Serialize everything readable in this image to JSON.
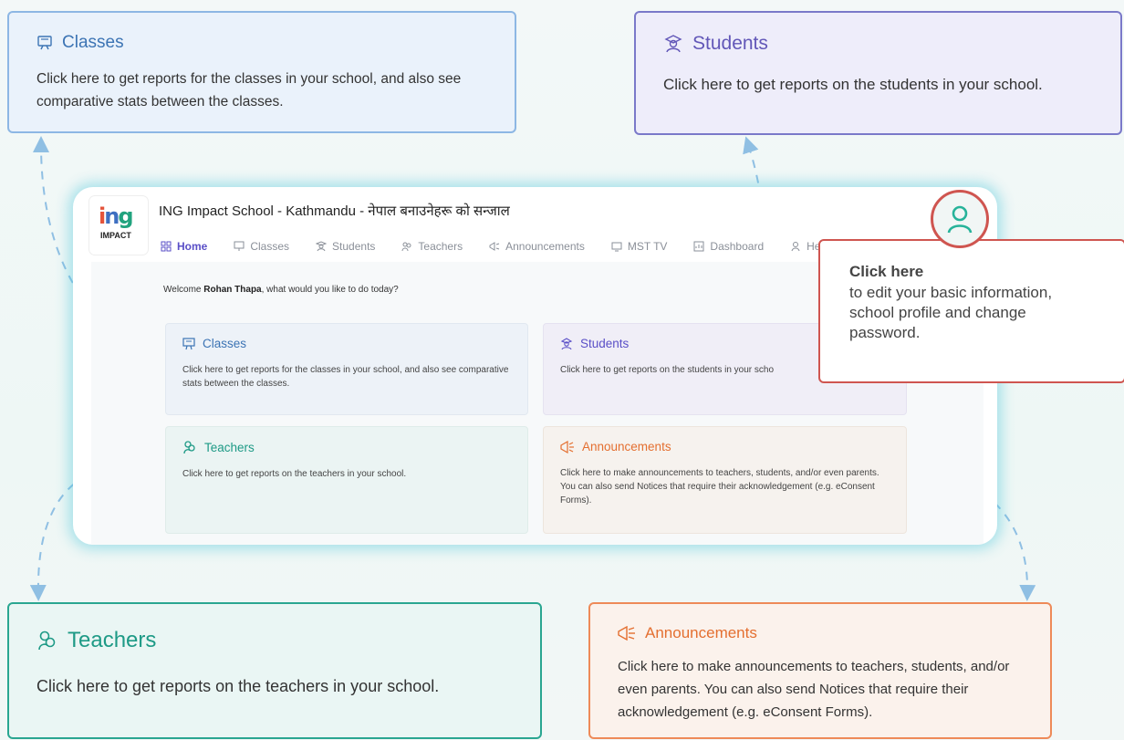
{
  "colors": {
    "classes": "#3c74b4",
    "students": "#6257b8",
    "teachers": "#1e9a86",
    "announcements": "#e46f30",
    "profile_border": "#cf5550",
    "nav_active": "#5a4fc7"
  },
  "callouts": {
    "classes": {
      "icon": "presentation-board-icon",
      "title": "Classes",
      "body": "Click here to get reports for the classes in your school, and also see comparative stats between the classes."
    },
    "students": {
      "icon": "student-graduate-icon",
      "title": "Students",
      "body": "Click here to get reports on the students in your school."
    },
    "teachers": {
      "icon": "teachers-group-icon",
      "title": "Teachers",
      "body": "Click here to get reports on the teachers in your school."
    },
    "announcements": {
      "icon": "megaphone-icon",
      "title": "Announcements",
      "body": "Click here to make announcements to teachers, students, and/or even parents. You can also send Notices that require their acknowledgement (e.g. eConsent Forms)."
    },
    "profile": {
      "icon": "user-profile-icon",
      "title": "Click here",
      "body": "to edit your basic information, school profile and change password."
    }
  },
  "app": {
    "logo_text": "ing",
    "logo_sub": "IMPACT",
    "school_name": "ING Impact School - Kathmandu - नेपाल बनाउनेहरू को सन्जाल",
    "nav": [
      {
        "label": "Home",
        "icon": "grid-icon",
        "active": true
      },
      {
        "label": "Classes",
        "icon": "presentation-board-icon"
      },
      {
        "label": "Students",
        "icon": "student-graduate-icon"
      },
      {
        "label": "Teachers",
        "icon": "teachers-group-icon"
      },
      {
        "label": "Announcements",
        "icon": "megaphone-icon"
      },
      {
        "label": "MST TV",
        "icon": "tv-icon"
      },
      {
        "label": "Dashboard",
        "icon": "dashboard-icon"
      },
      {
        "label": "He",
        "icon": "help-icon"
      }
    ],
    "welcome_prefix": "Welcome ",
    "welcome_name": "Rohan Thapa",
    "welcome_suffix": ", what would you like to do today?",
    "cards": {
      "classes": {
        "title": "Classes",
        "body": "Click here to get reports for the classes in your school, and also see comparative stats between the classes."
      },
      "students": {
        "title": "Students",
        "body": "Click here to get reports on the students in your scho"
      },
      "teachers": {
        "title": "Teachers",
        "body": "Click here to get reports on the teachers in your school."
      },
      "announcements": {
        "title": "Announcements",
        "body": "Click here to make announcements to teachers, students, and/or even parents. You can also send Notices that require their acknowledgement (e.g. eConsent Forms)."
      }
    }
  }
}
